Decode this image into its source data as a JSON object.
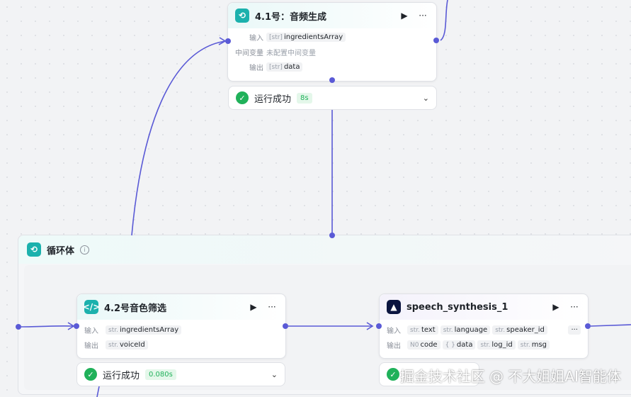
{
  "node_audio": {
    "title": "4.1号：音频生成",
    "input_label": "输入",
    "input_type": "[str]",
    "input_value": "ingredientsArray",
    "mid_label": "中间变量",
    "mid_value": "未配置中间变量",
    "output_label": "输出",
    "output_type": "[str]",
    "output_value": "data",
    "status": "运行成功",
    "time": "8s"
  },
  "loop": {
    "title": "循环体",
    "info": "i"
  },
  "node_voice": {
    "title": "4.2号音色筛选",
    "input_label": "输入",
    "input_type": "str.",
    "input_value": "ingredientsArray",
    "output_label": "输出",
    "output_type": "str.",
    "output_value": "voiceId",
    "status": "运行成功",
    "time": "0.080s"
  },
  "node_speech": {
    "title": "speech_synthesis_1",
    "input_label": "输入",
    "inputs": [
      {
        "type": "str.",
        "name": "text"
      },
      {
        "type": "str.",
        "name": "language"
      },
      {
        "type": "str.",
        "name": "speaker_id"
      }
    ],
    "more": "···",
    "output_label": "输出",
    "outputs": [
      {
        "type": "N0",
        "name": "code"
      },
      {
        "type": "{ }",
        "name": "data"
      },
      {
        "type": "str.",
        "name": "log_id"
      },
      {
        "type": "str.",
        "name": "msg"
      }
    ]
  },
  "icons": {
    "run": "play-icon",
    "menu": "more-icon",
    "success": "check-icon",
    "expand": "chevron-down-icon"
  },
  "colors": {
    "edge": "#5a5ad6",
    "success": "#20b15a",
    "accent": "#1bb1ad"
  },
  "watermark": "掘金技术社区 @ 不大姐姐AI智能体"
}
